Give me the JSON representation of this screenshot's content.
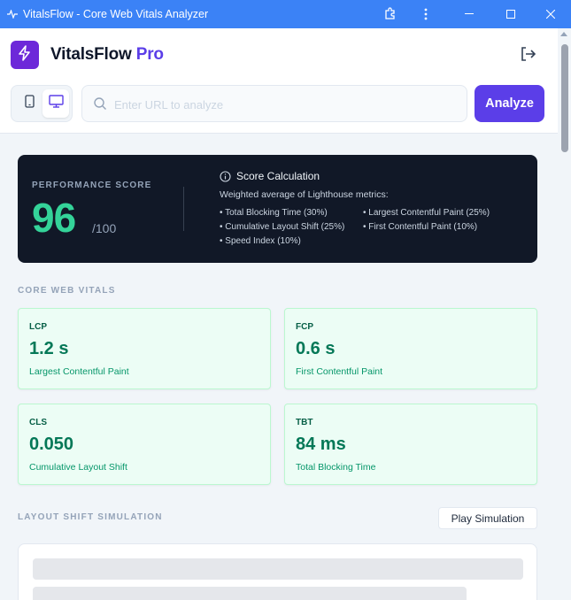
{
  "window": {
    "title": "VitalsFlow - Core Web Vitals Analyzer"
  },
  "header": {
    "brand_name": "VitalsFlow",
    "brand_suffix": "Pro",
    "search_placeholder": "Enter URL to analyze",
    "analyze_label": "Analyze",
    "selected_device": "desktop"
  },
  "score": {
    "label": "PERFORMANCE SCORE",
    "value": "96",
    "max": "/100",
    "calc_title": "Score Calculation",
    "calc_desc": "Weighted average of Lighthouse metrics:",
    "items": [
      "• Total Blocking Time (30%)",
      "• Largest Contentful Paint (25%)",
      "• Cumulative Layout Shift (25%)",
      "• First Contentful Paint (10%)",
      "• Speed Index (10%)"
    ]
  },
  "vitals": {
    "section_title": "CORE WEB VITALS",
    "metrics": [
      {
        "abbr": "LCP",
        "value": "1.2 s",
        "name": "Largest Contentful Paint"
      },
      {
        "abbr": "FCP",
        "value": "0.6 s",
        "name": "First Contentful Paint"
      },
      {
        "abbr": "CLS",
        "value": "0.050",
        "name": "Cumulative Layout Shift"
      },
      {
        "abbr": "TBT",
        "value": "84 ms",
        "name": "Total Blocking Time"
      }
    ]
  },
  "simulation": {
    "section_title": "LAYOUT SHIFT SIMULATION",
    "play_label": "Play Simulation"
  },
  "colors": {
    "titlebar": "#3b82f6",
    "accent": "#5b3ee8",
    "score_good": "#34d399",
    "metric_bg": "#ecfdf5"
  }
}
